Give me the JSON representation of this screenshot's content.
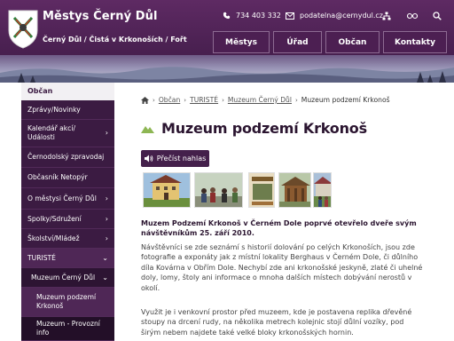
{
  "header": {
    "title": "Městys  Černý Důl",
    "subtitle": "Černý Důl / Čistá v Krkonoších / Fořt",
    "phone": "734 403 332",
    "email": "podatelna@cernydul.cz",
    "icons": [
      "phone-icon",
      "email-icon",
      "sitemap-icon",
      "glasses-icon",
      "search-icon"
    ],
    "colors": {
      "primary": "#4b2152",
      "accent": "#8db653"
    }
  },
  "topnav": [
    "Městys",
    "Úřad",
    "Občan",
    "Kontakty"
  ],
  "sidebar": {
    "items": [
      {
        "label": "Občan",
        "chevron": ""
      },
      {
        "label": "Zprávy/Novinky",
        "chevron": ""
      },
      {
        "label": "Kalendář akcí/ Události",
        "chevron": "›"
      },
      {
        "label": "Černodolský zpravodaj",
        "chevron": ""
      },
      {
        "label": "Občasník Netopýr",
        "chevron": ""
      },
      {
        "label": "O městysi Černý Důl",
        "chevron": "›"
      },
      {
        "label": "Spolky/Sdružení",
        "chevron": "›"
      },
      {
        "label": "Školství/Mládež",
        "chevron": "›"
      },
      {
        "label": "TURISTÉ",
        "chevron": "⌄"
      },
      {
        "label": "Muzeum Černý Důl",
        "chevron": "⌄"
      },
      {
        "label": "Muzeum podzemí Krkonoš",
        "chevron": ""
      },
      {
        "label": "Muzeum - Provozní info",
        "chevron": ""
      }
    ]
  },
  "breadcrumb": {
    "home_icon": "home-icon",
    "items": [
      "Občan",
      "TURISTÉ",
      "Muzeum Černý Důl"
    ],
    "current": "Muzeum podzemí Krkonoš"
  },
  "page": {
    "title": "Muzeum podzemí Krkonoš",
    "read_aloud": "Přečíst nahlas",
    "lead": "Muzem Podzemí Krkonoš v Černém Dole poprvé otevřelo dveře svým návštěvníkům 25. září 2010.",
    "paragraphs": [
      "Návštěvníci se zde seznámí s historií dolování po celých Krkonoších, jsou zde fotografie a exponáty jak z místní lokality Berghaus v Černém Dole, či důlního díla Kovárna v Obřím Dole. Nechybí zde ani krkonošské jeskyně, zlaté či uhelné doly, lomy, štoly ani informace o mnoha dalších místech dobývání nerostů v okolí.",
      "Využit je i venkovní prostor před muzeem, kde je postavena replika dřevěné stoupy na drcení rudy, na několika metrech kolejnic stojí důlní vozíky, pod širým nebem najdete také velké bloky krkonošských hornin."
    ],
    "gallery": [
      "photo-museum-building",
      "photo-exhibition-opening",
      "photo-book-cover",
      "photo-wooden-stamp-mill",
      "photo-visitors-outdoors"
    ]
  }
}
